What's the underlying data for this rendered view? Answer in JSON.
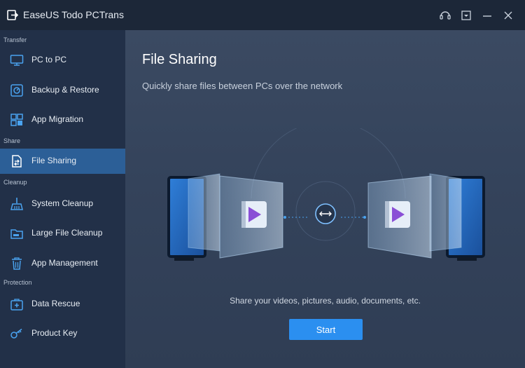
{
  "window": {
    "title": "EaseUS Todo PCTrans",
    "controls": [
      "support-icon",
      "dropdown-menu-icon",
      "minimize-icon",
      "close-icon"
    ]
  },
  "sidebar": {
    "sections": [
      {
        "label": "Transfer",
        "items": [
          {
            "label": "PC to PC",
            "icon": "monitor-icon"
          },
          {
            "label": "Backup & Restore",
            "icon": "backup-icon"
          },
          {
            "label": "App Migration",
            "icon": "app-migration-icon"
          }
        ]
      },
      {
        "label": "Share",
        "items": [
          {
            "label": "File Sharing",
            "icon": "file-sharing-icon",
            "active": true
          }
        ]
      },
      {
        "label": "Cleanup",
        "items": [
          {
            "label": "System Cleanup",
            "icon": "broom-icon"
          },
          {
            "label": "Large File Cleanup",
            "icon": "large-file-icon"
          },
          {
            "label": "App Management",
            "icon": "trash-icon"
          }
        ]
      },
      {
        "label": "Protection",
        "items": [
          {
            "label": "Data Rescue",
            "icon": "rescue-kit-icon"
          },
          {
            "label": "Product Key",
            "icon": "key-icon"
          }
        ]
      }
    ]
  },
  "main": {
    "title": "File Sharing",
    "subtitle": "Quickly share files between PCs over the network",
    "caption": "Share your videos, pictures, audio, documents, etc.",
    "start_label": "Start"
  },
  "colors": {
    "accent": "#2b8ff0",
    "active_item": "#2c5f97",
    "sidebar": "#223048",
    "titlebar": "#1c2738"
  }
}
